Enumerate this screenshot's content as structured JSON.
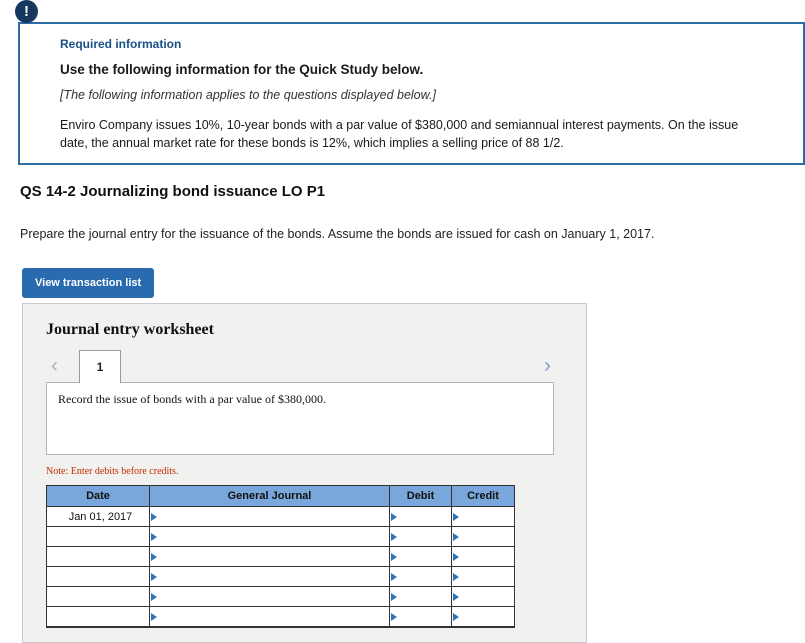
{
  "required_info": {
    "alert_glyph": "!",
    "label": "Required information",
    "title": "Use the following information for the Quick Study below.",
    "subtitle": "[The following information applies to the questions displayed below.]",
    "body": "Enviro Company issues 10%, 10-year bonds with a par value of $380,000 and semiannual interest payments. On the issue date, the annual market rate for these bonds is 12%, which implies a selling price of 88 1/2."
  },
  "question": {
    "heading": "QS 14-2 Journalizing bond issuance LO P1",
    "instruction": "Prepare the journal entry for the issuance of the bonds. Assume the bonds are issued for cash on January 1, 2017."
  },
  "toolbar": {
    "view_transaction_list_label": "View transaction list"
  },
  "worksheet": {
    "title": "Journal entry worksheet",
    "nav": {
      "prev": "‹",
      "tab": "1",
      "next": "›"
    },
    "prompt": "Record the issue of bonds with a par value of $380,000.",
    "note": "Note: Enter debits before credits.",
    "table": {
      "headers": [
        "Date",
        "General Journal",
        "Debit",
        "Credit"
      ],
      "rows": [
        {
          "date": "Jan 01, 2017",
          "journal": "",
          "debit": "",
          "credit": ""
        },
        {
          "date": "",
          "journal": "",
          "debit": "",
          "credit": ""
        },
        {
          "date": "",
          "journal": "",
          "debit": "",
          "credit": ""
        },
        {
          "date": "",
          "journal": "",
          "debit": "",
          "credit": ""
        },
        {
          "date": "",
          "journal": "",
          "debit": "",
          "credit": ""
        },
        {
          "date": "",
          "journal": "",
          "debit": "",
          "credit": ""
        }
      ]
    }
  },
  "colors": {
    "accent_blue": "#2A6BAF",
    "info_border": "#2E6DA4",
    "table_header": "#79A7DB",
    "note_red": "#C42A00",
    "marker_blue": "#2E75B6"
  }
}
